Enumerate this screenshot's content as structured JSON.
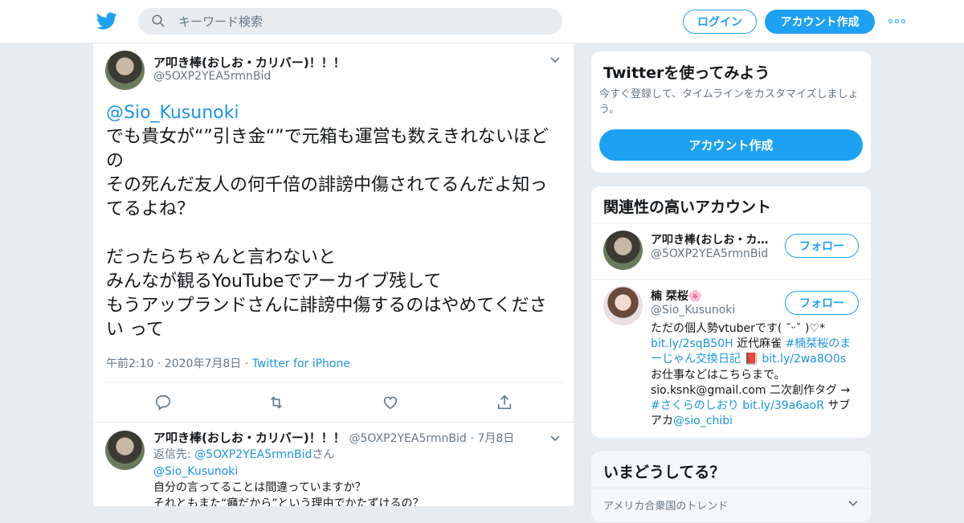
{
  "topbar": {
    "search_placeholder": "キーワード検索",
    "login_label": "ログイン",
    "signup_label": "アカウント作成"
  },
  "tweet": {
    "author_name": "ア叩き棒(おしお・カリバー)！！！",
    "author_handle": "@5OXP2YEA5rmnBid",
    "mention": "@Sio_Kusunoki",
    "body": "でも貴女が“”引き金“”で元箱も運営も数えきれないほどの\nその死んだ友人の何千倍の誹謗中傷されてるんだよ知ってるよね？\n\nだったらちゃんと言わないと\nみんなが観るYouTubeでアーカイブ残して\nもうアップランドさんに誹謗中傷するのはやめてください って",
    "time": "午前2:10",
    "date": "2020年7月8日",
    "source": "Twitter for iPhone"
  },
  "reply": {
    "author_name": "ア叩き棒(おしお・カリバー)！！！",
    "author_handle": "@5OXP2YEA5rmnBid",
    "date": "7月8日",
    "reply_to_prefix": "返信先: ",
    "reply_to_handle": "@5OXP2YEA5rmnBid",
    "reply_to_suffix": "さん",
    "mention": "@Sio_Kusunoki",
    "line1": "自分の言ってることは間違っていますか？",
    "line2": "それともまた“癪だから”という理由でかたずけるの？"
  },
  "try_twitter": {
    "title": "Twitterを使ってみよう",
    "desc": "今すぐ登録して、タイムラインをカスタマイズしましょう。",
    "button": "アカウント作成"
  },
  "related": {
    "title": "関連性の高いアカウント",
    "follow_label": "フォロー",
    "accounts": [
      {
        "name": "ア叩き棒(おしお・カ…",
        "handle": "@5OXP2YEA5rmnBid"
      },
      {
        "name": "楠 栞桜🌸",
        "handle": "@Sio_Kusunoki"
      }
    ],
    "bio": {
      "t1": "ただの個人勢vtuberです( ˘ᵕ˘ )♡*",
      "l1": "bit.ly/2sqB50H",
      "t2": " 近代麻雀 ",
      "l2": "#楠栞桜のまーじゃん交換日記",
      "t3": " 📕 ",
      "l3": "bit.ly/2wa8O0s",
      "t4": "お仕事などはこちらまで。 sio.ksnk@gmail.com 二次創作タグ → ",
      "l4": "#さくらのしおり",
      "t5": " ",
      "l5": "bit.ly/39a6aoR",
      "t6": " サブアカ",
      "l6": "@sio_chibi"
    }
  },
  "trends": {
    "title": "いまどうしてる？",
    "subtitle": "アメリカ合衆国のトレンド"
  },
  "colors": {
    "accent": "#1da1f2",
    "link": "#1b95e0",
    "muted": "#657786",
    "bg": "#e6ecf0"
  }
}
